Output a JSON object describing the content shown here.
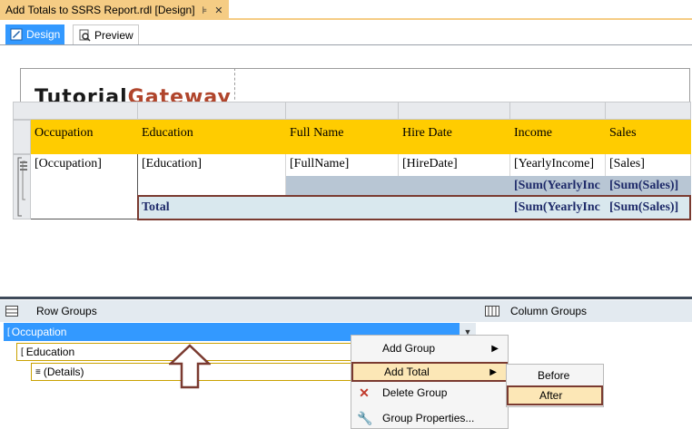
{
  "document": {
    "title": "Add Totals to SSRS Report.rdl [Design]",
    "pin_glyph": "⊧",
    "close_glyph": "✕"
  },
  "view_tabs": [
    {
      "label": "Design",
      "active": true
    },
    {
      "label": "Preview",
      "active": false
    }
  ],
  "report": {
    "logo_part1": "Tutorial",
    "logo_part2": "Gateway",
    "headers": [
      "Occupation",
      "Education",
      "Full Name",
      "Hire Date",
      "Income",
      "Sales"
    ],
    "detail_row": [
      "[Occupation]",
      "[Education]",
      "[FullName]",
      "[HireDate]",
      "[YearlyIncome]",
      "[Sales]"
    ],
    "subtotal_row": {
      "income": "[Sum(YearlyInc",
      "sales": "[Sum(Sales)]"
    },
    "total_row": {
      "label": "Total",
      "income": "[Sum(YearlyInc",
      "sales": "[Sum(Sales)]"
    },
    "colors": {
      "header": "#ffcc00",
      "subtotal": "#b8c6d4",
      "total": "#d9e8ee",
      "highlight_border": "#7a3a30"
    }
  },
  "groups": {
    "row_groups_label": "Row Groups",
    "column_groups_label": "Column Groups",
    "items": [
      "Occupation",
      "Education",
      "(Details)"
    ]
  },
  "context_menu": {
    "items": [
      "Add Group",
      "Add Total",
      "Delete Group",
      "Group Properties..."
    ],
    "submenu": [
      "Before",
      "After"
    ]
  }
}
